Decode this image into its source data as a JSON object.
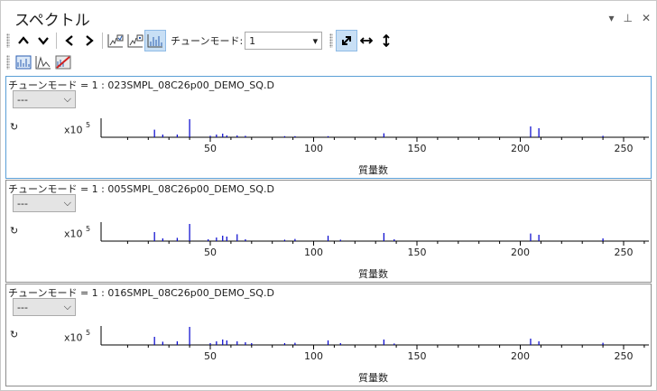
{
  "window": {
    "title": "スペクトル"
  },
  "toolbar": {
    "tune_mode_label": "チューンモード:",
    "tune_mode_value": "1"
  },
  "panels": [
    {
      "title": "チューンモード = 1 : 023SMPL_08C26p00_DEMO_SQ.D",
      "dropdown_value": "---",
      "multiplier": "x10",
      "exponent": "5",
      "xlabel": "質量数"
    },
    {
      "title": "チューンモード = 1 : 005SMPL_08C26p00_DEMO_SQ.D",
      "dropdown_value": "---",
      "multiplier": "x10",
      "exponent": "5",
      "xlabel": "質量数"
    },
    {
      "title": "チューンモード = 1 : 016SMPL_08C26p00_DEMO_SQ.D",
      "dropdown_value": "---",
      "multiplier": "x10",
      "exponent": "5",
      "xlabel": "質量数"
    }
  ],
  "chart_data": [
    {
      "type": "bar",
      "xlim": [
        0,
        265
      ],
      "x_ticks": [
        "50",
        "100",
        "150",
        "200",
        "250"
      ],
      "xlabel": "質量数",
      "y_multiplier": "x10^5",
      "peaks": [
        [
          23,
          0.42
        ],
        [
          27,
          0.15
        ],
        [
          34,
          0.15
        ],
        [
          40,
          1.0
        ],
        [
          50,
          0.08
        ],
        [
          53,
          0.15
        ],
        [
          56,
          0.2
        ],
        [
          58,
          0.1
        ],
        [
          63,
          0.1
        ],
        [
          67,
          0.08
        ],
        [
          86,
          0.06
        ],
        [
          91,
          0.06
        ],
        [
          107,
          0.06
        ],
        [
          134,
          0.22
        ],
        [
          205,
          0.6
        ],
        [
          209,
          0.5
        ],
        [
          240,
          0.08
        ]
      ]
    },
    {
      "type": "bar",
      "xlim": [
        0,
        265
      ],
      "x_ticks": [
        "50",
        "100",
        "150",
        "200",
        "250"
      ],
      "xlabel": "質量数",
      "y_multiplier": "x10^5",
      "peaks": [
        [
          23,
          0.5
        ],
        [
          27,
          0.15
        ],
        [
          34,
          0.18
        ],
        [
          40,
          0.95
        ],
        [
          49,
          0.1
        ],
        [
          53,
          0.2
        ],
        [
          56,
          0.3
        ],
        [
          58,
          0.25
        ],
        [
          63,
          0.38
        ],
        [
          67,
          0.1
        ],
        [
          86,
          0.08
        ],
        [
          91,
          0.12
        ],
        [
          107,
          0.3
        ],
        [
          113,
          0.08
        ],
        [
          134,
          0.45
        ],
        [
          139,
          0.1
        ],
        [
          205,
          0.42
        ],
        [
          209,
          0.35
        ],
        [
          240,
          0.15
        ]
      ]
    },
    {
      "type": "bar",
      "xlim": [
        0,
        265
      ],
      "x_ticks": [
        "50",
        "100",
        "150",
        "200",
        "250"
      ],
      "xlabel": "質量数",
      "y_multiplier": "x10^5",
      "peaks": [
        [
          23,
          0.45
        ],
        [
          27,
          0.18
        ],
        [
          34,
          0.2
        ],
        [
          40,
          1.0
        ],
        [
          50,
          0.1
        ],
        [
          53,
          0.2
        ],
        [
          56,
          0.3
        ],
        [
          58,
          0.25
        ],
        [
          63,
          0.2
        ],
        [
          67,
          0.15
        ],
        [
          70,
          0.1
        ],
        [
          86,
          0.1
        ],
        [
          91,
          0.12
        ],
        [
          107,
          0.25
        ],
        [
          113,
          0.1
        ],
        [
          134,
          0.3
        ],
        [
          139,
          0.08
        ],
        [
          205,
          0.35
        ],
        [
          209,
          0.2
        ],
        [
          240,
          0.12
        ]
      ]
    }
  ]
}
